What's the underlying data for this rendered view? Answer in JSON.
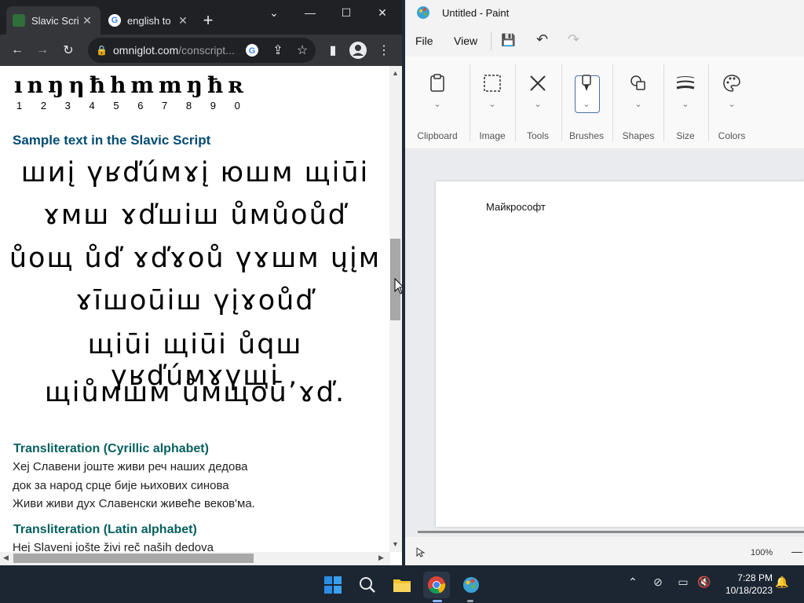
{
  "chrome": {
    "tabs": [
      {
        "title": "Slavic Scri",
        "active": true
      },
      {
        "title": "english to",
        "active": false
      }
    ],
    "new_tab": "+",
    "url_host": "omniglot.com",
    "url_path": "/conscript...",
    "window_controls": {
      "minimize": "—",
      "maximize": "☐",
      "close": "✕",
      "tabsearch": "⌄"
    }
  },
  "page": {
    "glyph_row": "ınŋηħhmmŋħʀ",
    "digits": "1 2 3 4 5 6 7 8 9 0",
    "sample_heading": "Sample text in the Slavic Script",
    "sample_lines": [
      "шиį үʁďúмɤį юшм щiūi",
      "ɤмш ɤďшiш ůмůoůď",
      "ůoщ ůď ɤďɤoů үɤшм ųįм",
      "ɤīшoūiш үįɤoůď",
      "щiūi щiūi ůqш үʁďúмɤүщi",
      "щiůмшм ůмщoū’ɤď."
    ],
    "cyrillic_heading": "Transliteration (Cyrillic alphabet)",
    "cyrillic_lines": [
      "Хеј Славени јоште живи реч наших дедова",
      "док за народ срце бије њихових синова",
      "Живи живи дух Славенски живеће веков'ма."
    ],
    "latin_heading": "Transliteration (Latin alphabet)",
    "latin_lines": [
      "Hej Slaveni jošte živi reč naših dedova"
    ]
  },
  "paint": {
    "title": "Untitled - Paint",
    "menu": {
      "file": "File",
      "view": "View"
    },
    "groups": [
      {
        "label": "Clipboard",
        "icon": "clipboard-icon"
      },
      {
        "label": "Image",
        "icon": "select-icon"
      },
      {
        "label": "Tools",
        "icon": "tools-icon"
      },
      {
        "label": "Brushes",
        "icon": "brush-icon"
      },
      {
        "label": "Shapes",
        "icon": "shapes-icon"
      },
      {
        "label": "Size",
        "icon": "size-icon"
      },
      {
        "label": "Colors",
        "icon": "palette-icon"
      }
    ],
    "canvas_text": "Майкрософт",
    "zoom": "100%"
  },
  "taskbar": {
    "time": "7:28 PM",
    "date": "10/18/2023"
  },
  "colors": {
    "accent": "#4a6fa5",
    "heading": "#034b72",
    "heading2": "#076060"
  }
}
